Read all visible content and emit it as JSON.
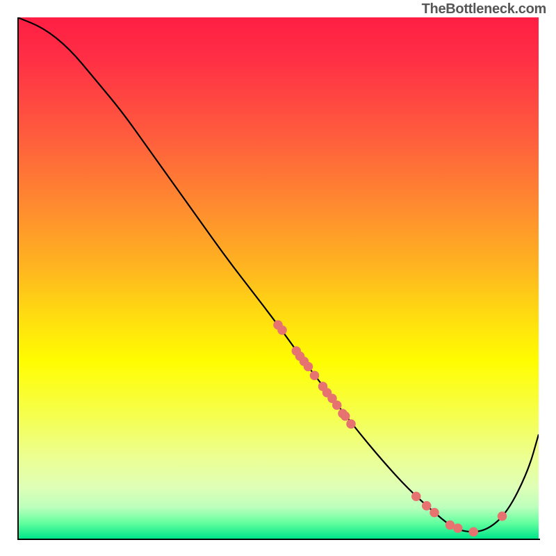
{
  "watermark": "TheBottleneck.com",
  "chart_data": {
    "type": "line",
    "title": "",
    "xlabel": "",
    "ylabel": "",
    "xlim": [
      0,
      100
    ],
    "ylim": [
      0,
      100
    ],
    "grid": false,
    "legend": false,
    "note": "Axis tick labels are not visible in the image; x and y are expressed as 0–100 percent of the plot area (x left→right, y bottom→top).",
    "series": [
      {
        "name": "bottleneck-curve",
        "color": "#000000",
        "x": [
          0,
          5,
          10,
          15,
          20,
          25,
          30,
          35,
          40,
          45,
          50,
          55,
          60,
          65,
          70,
          75,
          80,
          83,
          86,
          90,
          94,
          98,
          100
        ],
        "y": [
          100,
          98,
          94,
          88,
          82,
          75,
          68,
          61,
          54,
          47.5,
          41,
          34,
          27.5,
          21,
          15,
          9.5,
          5,
          2.5,
          1.2,
          1.5,
          5,
          13,
          20
        ]
      }
    ],
    "scatter": {
      "name": "highlight-dots",
      "color": "#e6736f",
      "radius_pct": 0.9,
      "points": [
        {
          "x": 50.0,
          "y": 41.0
        },
        {
          "x": 50.8,
          "y": 40.0
        },
        {
          "x": 53.5,
          "y": 36.0
        },
        {
          "x": 54.2,
          "y": 35.0
        },
        {
          "x": 55.0,
          "y": 34.0
        },
        {
          "x": 55.8,
          "y": 33.0
        },
        {
          "x": 57.0,
          "y": 31.3
        },
        {
          "x": 58.6,
          "y": 29.2
        },
        {
          "x": 59.4,
          "y": 28.0
        },
        {
          "x": 60.4,
          "y": 26.9
        },
        {
          "x": 61.3,
          "y": 25.6
        },
        {
          "x": 62.4,
          "y": 24.0
        },
        {
          "x": 62.9,
          "y": 23.5
        },
        {
          "x": 64.0,
          "y": 22.0
        },
        {
          "x": 76.5,
          "y": 8.1
        },
        {
          "x": 78.5,
          "y": 6.3
        },
        {
          "x": 80.0,
          "y": 5.0
        },
        {
          "x": 83.0,
          "y": 2.6
        },
        {
          "x": 84.5,
          "y": 2.0
        },
        {
          "x": 87.5,
          "y": 1.3
        },
        {
          "x": 93.0,
          "y": 4.3
        }
      ]
    }
  }
}
